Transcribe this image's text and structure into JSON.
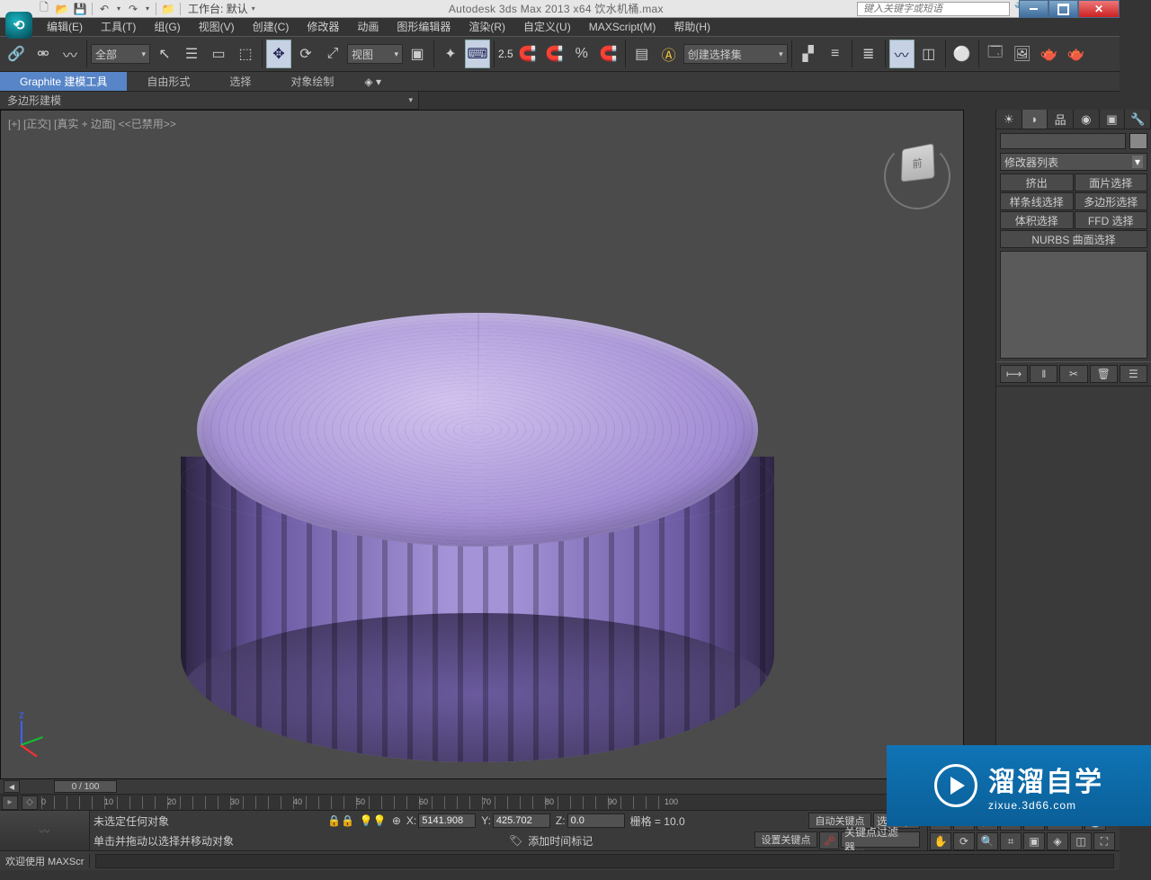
{
  "title": {
    "full": "Autodesk 3ds Max  2013 x64     饮水机桶.max"
  },
  "qat": {
    "workspace_label": "工作台: 默认"
  },
  "search": {
    "placeholder": "键入关键字或短语"
  },
  "menu": [
    "编辑(E)",
    "工具(T)",
    "组(G)",
    "视图(V)",
    "创建(C)",
    "修改器",
    "动画",
    "图形编辑器",
    "渲染(R)",
    "自定义(U)",
    "MAXScript(M)",
    "帮助(H)"
  ],
  "toolbar": {
    "filter_all": "全部",
    "refcoord": "视图",
    "snap_value": "2.5",
    "named_sel": "创建选择集"
  },
  "ribbon": {
    "tabs": [
      "Graphite 建模工具",
      "自由形式",
      "选择",
      "对象绘制"
    ],
    "sub": "多边形建模"
  },
  "viewport": {
    "label": "[+] [正交] [真实 + 边面]  <<已禁用>>"
  },
  "cmdpanel": {
    "modifier_list": "修改器列表",
    "buttons": [
      "挤出",
      "面片选择",
      "样条线选择",
      "多边形选择",
      "体积选择",
      "FFD 选择",
      "NURBS 曲面选择"
    ]
  },
  "time": {
    "slider": "0 / 100",
    "ticks": [
      "0",
      "10",
      "20",
      "30",
      "40",
      "50",
      "60",
      "70",
      "80",
      "90",
      "100"
    ]
  },
  "status": {
    "sel": "未选定任何对象",
    "hint": "单击并拖动以选择并移动对象",
    "x": "5141.908",
    "y": "425.702",
    "z": "0.0",
    "grid": "栅格 = 10.0",
    "autokey": "自动关键点",
    "setkey": "设置关键点",
    "addtimemk": "添加时间标记",
    "selset": "选定对",
    "keyfilter": "关键点过滤器..."
  },
  "footer": {
    "welcome": "欢迎使用  MAXScr",
    "prompt": ""
  },
  "watermark": {
    "big": "溜溜自学",
    "small": "zixue.3d66.com"
  }
}
